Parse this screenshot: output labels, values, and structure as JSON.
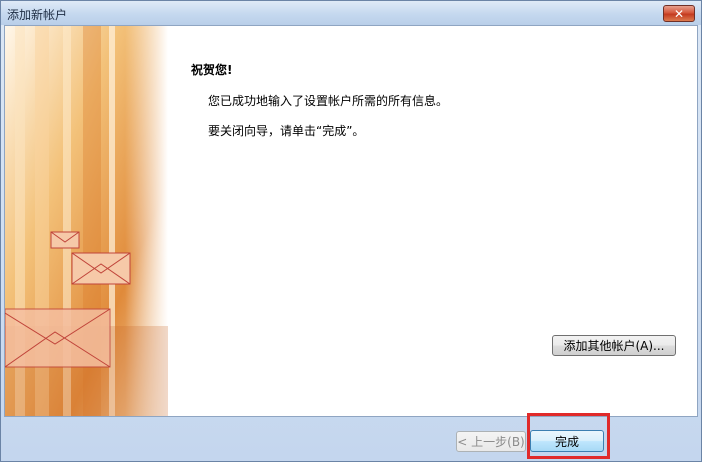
{
  "window": {
    "title": "添加新帐户"
  },
  "colors": {
    "highlight": "#e02a2a",
    "art_orange": "#e8913c"
  },
  "content": {
    "heading": "祝贺您!",
    "line1": "您已成功地输入了设置帐户所需的所有信息。",
    "line2": "要关闭向导，请单击“完成”。"
  },
  "buttons": {
    "add_other": "添加其他帐户(A)...",
    "back": "< 上一步(B)",
    "finish": "完成",
    "close": "✕"
  }
}
